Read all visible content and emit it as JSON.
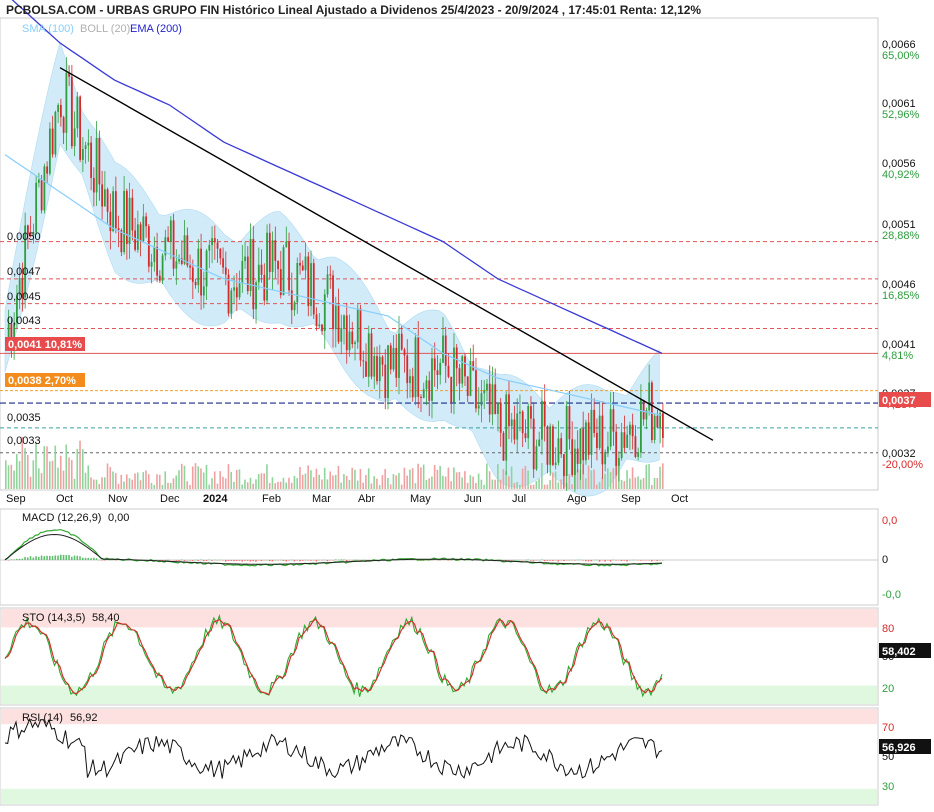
{
  "header": {
    "title": "PCBOLSA.COM - URBAS GRUPO FIN Histórico Lineal Ajustado a Dividenos 25/4/2023 - 20/9/2024 , 17:45:01 Renta: 12,12%",
    "legend": [
      {
        "label": "SMA (100)",
        "color": "#87cefa"
      },
      {
        "label": "BOLL (20)",
        "color": "#c0c0c0"
      },
      {
        "label": "EMA (200)",
        "color": "#2222cc"
      }
    ]
  },
  "colors": {
    "up": "#2e9e3e",
    "down": "#d62a2a",
    "boll_fill": "#cde9f9",
    "sma": "#87cefa",
    "ema": "#3a3ad6",
    "trendline": "#000000",
    "sto_k": "#2ea82e",
    "sto_d": "#d62a2a",
    "overbought": "#fde0e0",
    "oversold": "#e0f8e0"
  },
  "price_axis": {
    "ticks": [
      "0,0066",
      "0,0061",
      "0,0056",
      "0,0051",
      "0,0046",
      "0,0041",
      "0,0037",
      "0,0032"
    ],
    "percents": [
      "65,00%",
      "52,96%",
      "40,92%",
      "28,88%",
      "16,85%",
      "4,81%",
      "-7,23%",
      "-20,00%"
    ],
    "current_label": "0,0037"
  },
  "levels": [
    {
      "label": "0,0050",
      "value": 0.005
    },
    {
      "label": "0,0047",
      "value": 0.0047
    },
    {
      "label": "0,0045",
      "value": 0.0045
    },
    {
      "label": "0,0043",
      "value": 0.0043
    },
    {
      "label": "0,0041  10,81%",
      "value": 0.0041
    },
    {
      "label": "0,0038  2,70%",
      "value": 0.0038
    },
    {
      "label": "0,0035",
      "value": 0.0035
    },
    {
      "label": "0,0033",
      "value": 0.0033
    }
  ],
  "x_axis": {
    "labels": [
      "Sep",
      "Oct",
      "Nov",
      "Dec",
      "2024",
      "Feb",
      "Mar",
      "Abr",
      "May",
      "Jun",
      "Jul",
      "Ago",
      "Sep",
      "Oct"
    ]
  },
  "macd": {
    "title": "MACD (12,26,9)",
    "value": "0,00",
    "ticks": [
      "0,0",
      "0",
      "-0,0"
    ]
  },
  "sto": {
    "title": "STO (14,3,5)",
    "value": "58,40",
    "readout": "58,402",
    "ticks": [
      "80",
      "50",
      "20"
    ]
  },
  "rsi": {
    "title": "RSI (14)",
    "value": "56,92",
    "readout": "56,926",
    "ticks": [
      "70",
      "50",
      "30"
    ]
  },
  "chart_data": {
    "type": "line",
    "title": "PCBOLSA.COM - URBAS GRUPO FIN Histórico Lineal Ajustado a Dividenos 25/4/2023 - 20/9/2024 , 17:45:01 Renta: 12,12%",
    "x": [
      "Sep",
      "Oct",
      "Nov",
      "Dec",
      "2024",
      "Feb",
      "Mar",
      "Abr",
      "May",
      "Jun",
      "Jul",
      "Ago",
      "Sep"
    ],
    "ylim": [
      0.003,
      0.0068
    ],
    "series": [
      {
        "name": "",
        "values": [
          0.0042,
          0.0062,
          0.0052,
          0.0049,
          0.0047,
          0.0048,
          0.0045,
          0.004,
          0.004,
          0.0035,
          0.0034,
          0.0034,
          0.0037
        ]
      },
      {
        "name": "EMA (200)",
        "values": [
          0.007,
          0.0066,
          0.0063,
          0.0061,
          0.0058,
          0.0056,
          0.0054,
          0.0052,
          0.005,
          0.0047,
          0.0045,
          0.0043,
          0.0041
        ]
      },
      {
        "name": "SMA (100)",
        "values": [
          0.0057,
          0.0054,
          0.0051,
          0.0049,
          0.0047,
          0.0046,
          0.0045,
          0.0044,
          0.0041,
          0.0039,
          0.0038,
          0.0037,
          0.0036
        ]
      }
    ],
    "trendline": [
      [
        60,
        0.0064
      ],
      [
        713,
        0.0034
      ]
    ],
    "macd_range": [
      -0.0002,
      0.0002
    ],
    "sto_range": [
      0,
      100
    ],
    "rsi_range": [
      20,
      80
    ]
  }
}
